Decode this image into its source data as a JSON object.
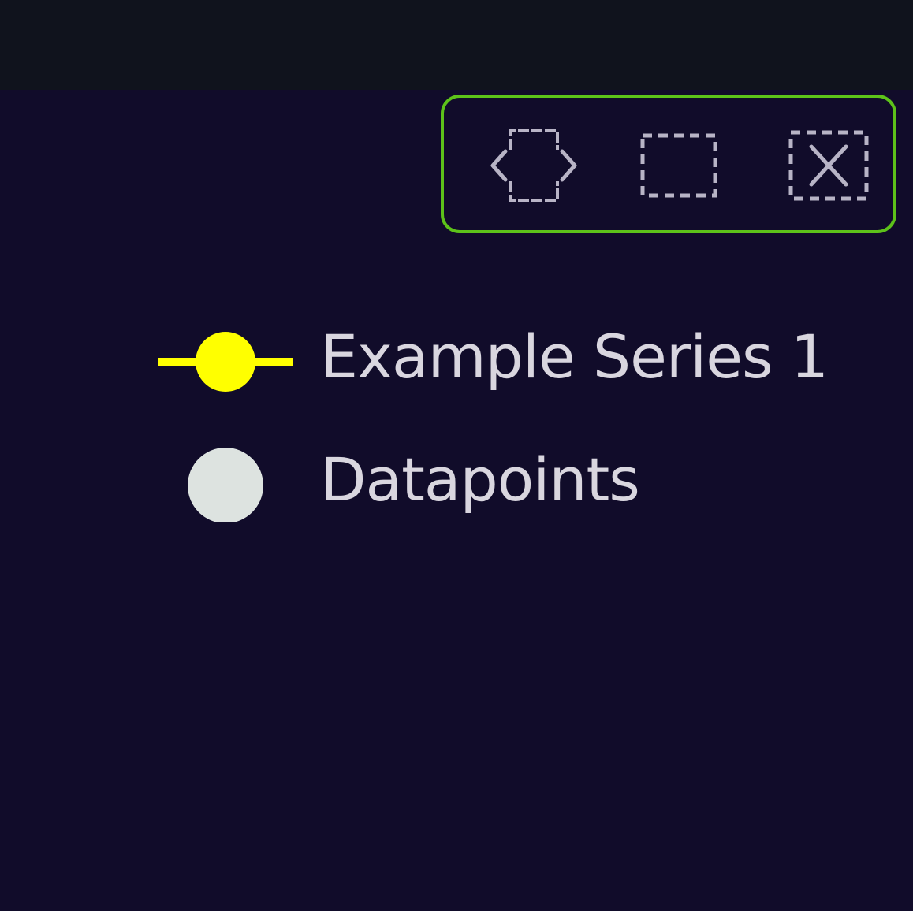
{
  "colors": {
    "background": "#110c2a",
    "topbar": "#10131d",
    "toolbox_border": "#5dc21a",
    "icon": "#b8b4c6",
    "series_1": "#ffff00",
    "datapoints": "#dde3e0",
    "legend_text": "#d9d6df"
  },
  "toolbox": {
    "tools": [
      {
        "icon": "data-zoom-icon"
      },
      {
        "icon": "box-select-icon"
      },
      {
        "icon": "clear-selection-icon"
      }
    ]
  },
  "legend": {
    "items": [
      {
        "label": "Example Series 1",
        "symbol": "line-with-circle",
        "color": "#ffff00"
      },
      {
        "label": "Datapoints",
        "symbol": "circle",
        "color": "#dde3e0"
      }
    ]
  }
}
